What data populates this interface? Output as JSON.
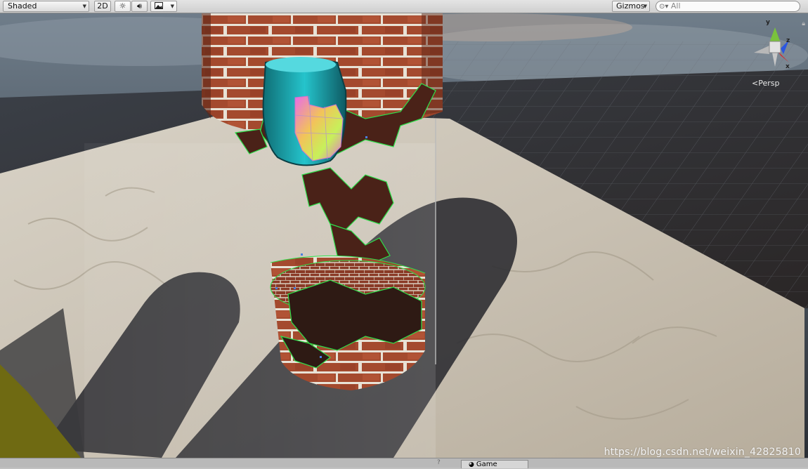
{
  "toolbar": {
    "draw_mode": "Shaded",
    "mode_2d": "2D",
    "lighting_icon": "sun-icon",
    "audio_icon": "speaker-icon",
    "effects_icon": "image-icon",
    "gizmos_label": "Gizmos",
    "search_placeholder": "All",
    "search_icon": "search-icon"
  },
  "scene": {
    "projection_label": "Persp",
    "axis_labels": {
      "x": "x",
      "y": "y",
      "z": "z"
    },
    "axis_colors": {
      "x": "#d8262a",
      "y": "#7ac23c",
      "z": "#2b56e0"
    }
  },
  "watermark": "https://blog.csdn.net/weixin_42825810",
  "bottom_tabs": {
    "game_label": "Game",
    "game_icon": "pacman-icon",
    "overflow_marker": "?"
  }
}
